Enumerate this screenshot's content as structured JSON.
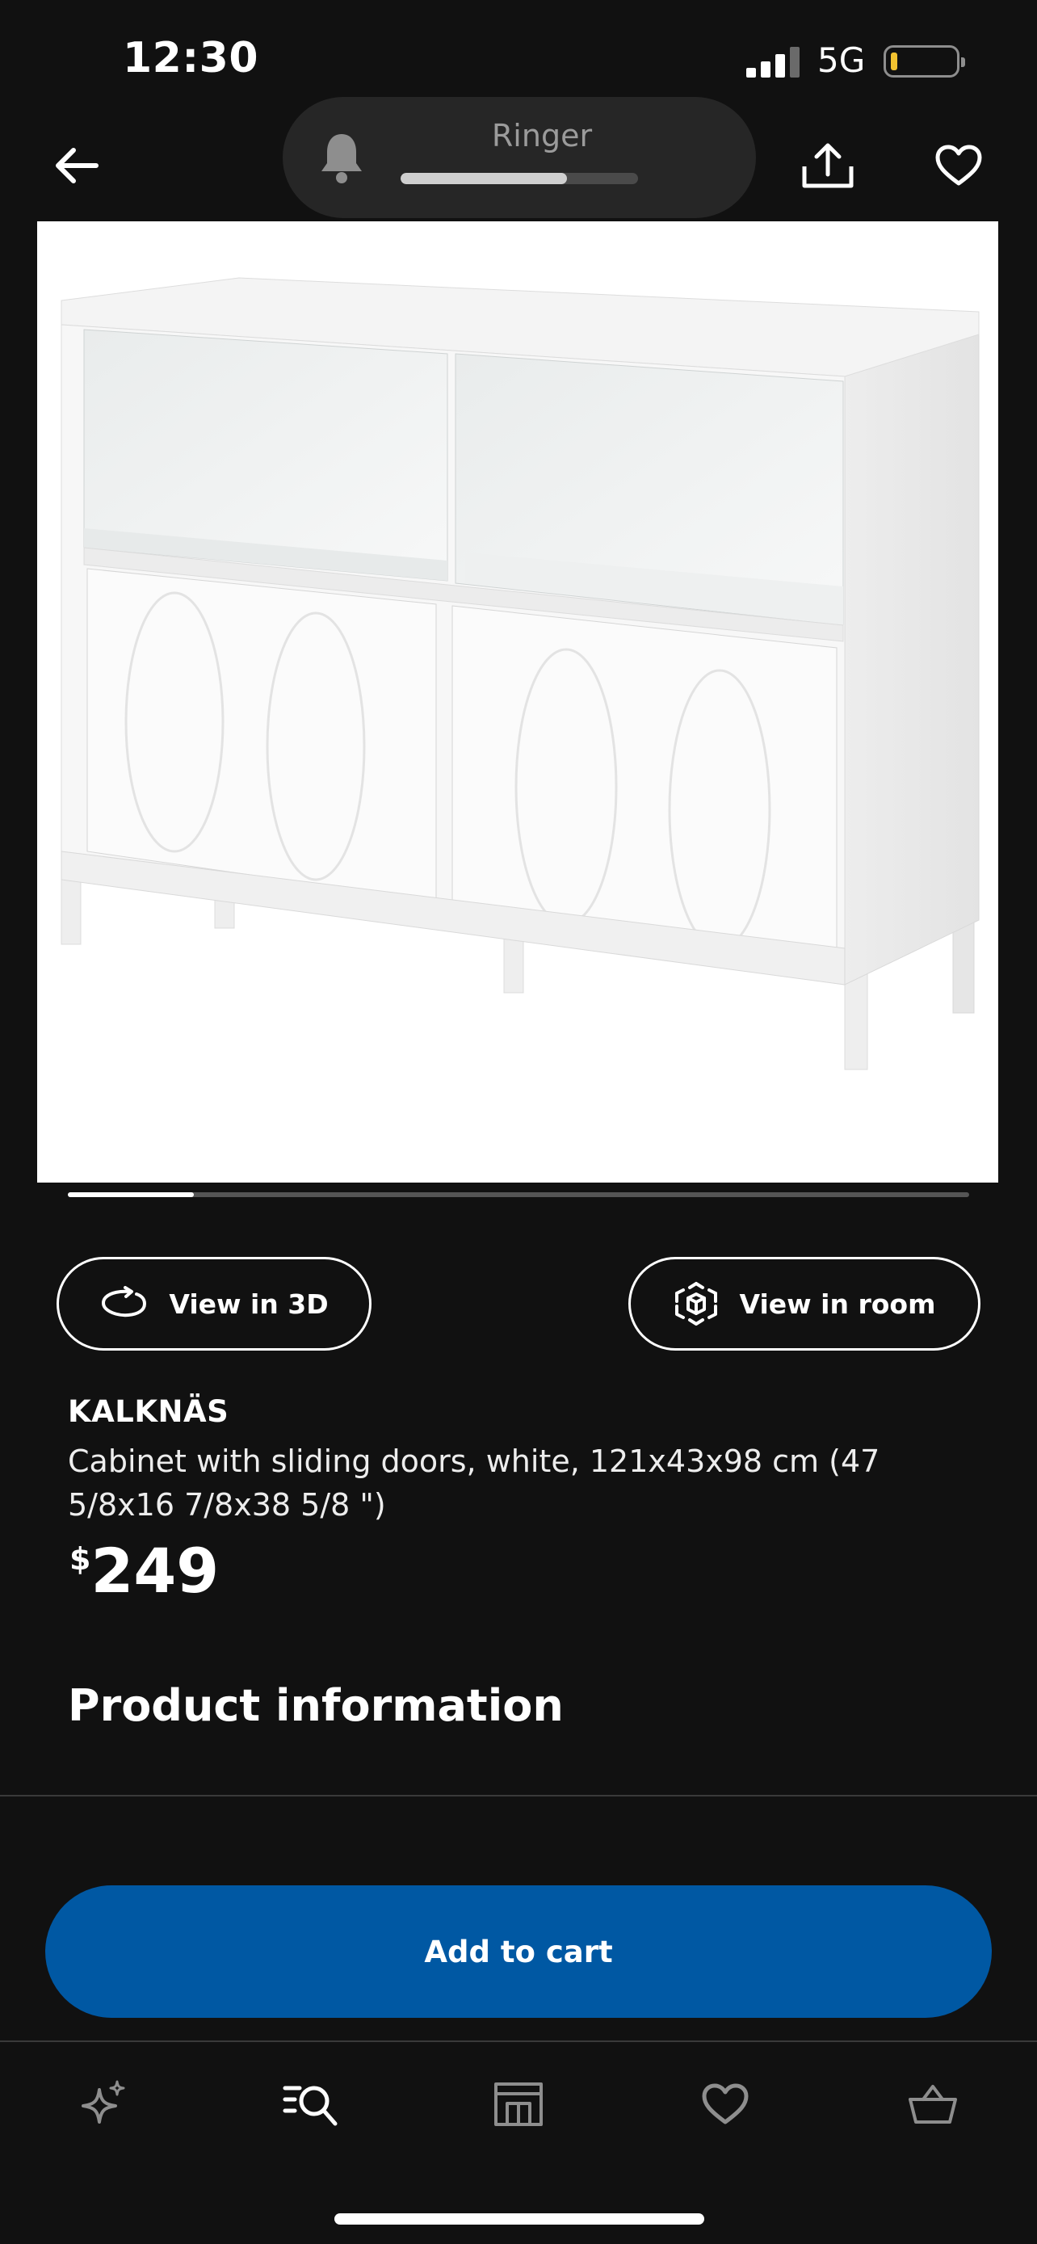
{
  "status_bar": {
    "time": "12:30",
    "network": "5G",
    "battery_level": 0.08
  },
  "ringer": {
    "label": "Ringer",
    "volume": 0.7
  },
  "carousel": {
    "position": 0.14
  },
  "actions": {
    "view_3d": "View in 3D",
    "view_room": "View in room"
  },
  "product": {
    "name": "KALKNÄS",
    "description": "Cabinet with sliding doors, white, 121x43x98 cm (47 5/8x16 7/8x38 5/8 \")",
    "currency": "$",
    "price": "249"
  },
  "section": {
    "product_information": "Product information"
  },
  "cart": {
    "label": "Add to cart"
  },
  "tabs": [
    "inspiration-icon",
    "search-icon",
    "stores-icon",
    "wishlist-icon",
    "basket-icon"
  ],
  "colors": {
    "accent": "#0058a3",
    "background": "#111111",
    "battery_low": "#f2c230"
  }
}
